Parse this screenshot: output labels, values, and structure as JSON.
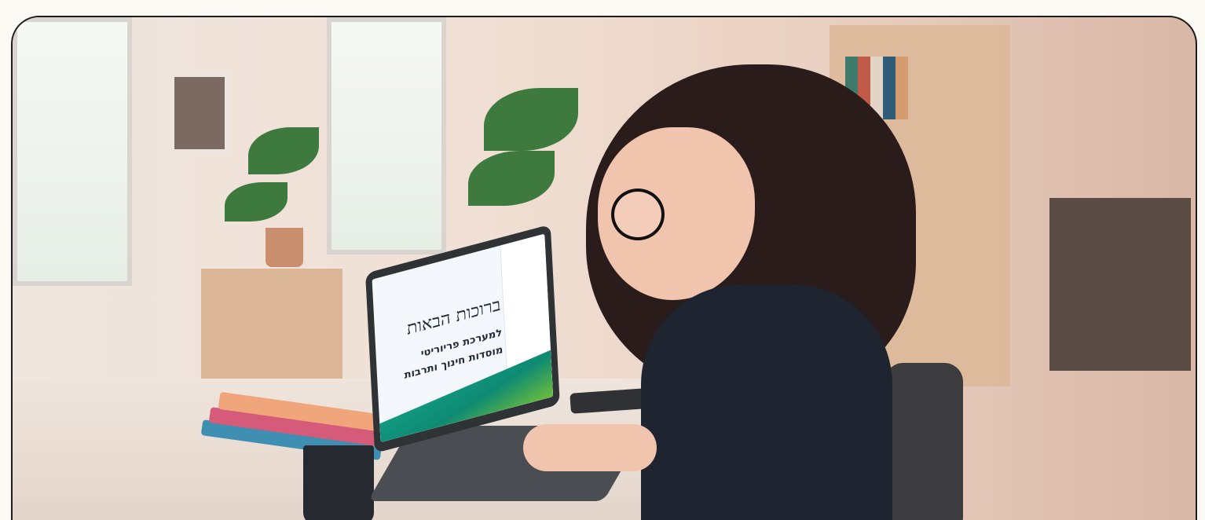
{
  "laptop_screen": {
    "title": "ברוכות הבאות",
    "subtitle_line1": "למערכת פריוריטי",
    "subtitle_line2": "מוסדות חינוך ותרבות"
  },
  "colors": {
    "background": "#fbf9f3",
    "frame_border": "#1c1c1c",
    "screen_accent": "#15a58a"
  }
}
